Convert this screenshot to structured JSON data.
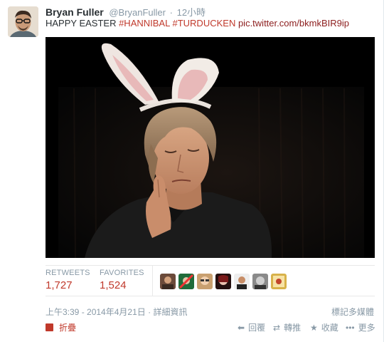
{
  "tweet": {
    "fullname": "Bryan Fuller",
    "username": "@BryanFuller",
    "dot": "·",
    "time": "12小時",
    "text_plain": "HAPPY EASTER ",
    "hashtag1": "#HANNIBAL",
    "hashtag2": "#TURDUCKEN",
    "pic_link": "pic.twitter.com/bkmkBIR9ip"
  },
  "stats": {
    "retweets_label": "RETWEETS",
    "retweets_value": "1,727",
    "favorites_label": "FAVORITES",
    "favorites_value": "1,524",
    "faces_count": 8
  },
  "meta": {
    "timestamp": "上午3:39 - 2014年4月21日",
    "details_link": "詳細資訊",
    "flag_media": "標記多媒體"
  },
  "actions": {
    "collapse": "折疊",
    "reply": "回覆",
    "retweet": "轉推",
    "favorite": "收藏",
    "more": "更多"
  },
  "colors": {
    "link": "#c0392b",
    "muted": "#8899a6",
    "text": "#292f33"
  },
  "icons": [
    "reply-icon",
    "retweet-icon",
    "star-icon",
    "more-icon",
    "collapse-icon"
  ]
}
